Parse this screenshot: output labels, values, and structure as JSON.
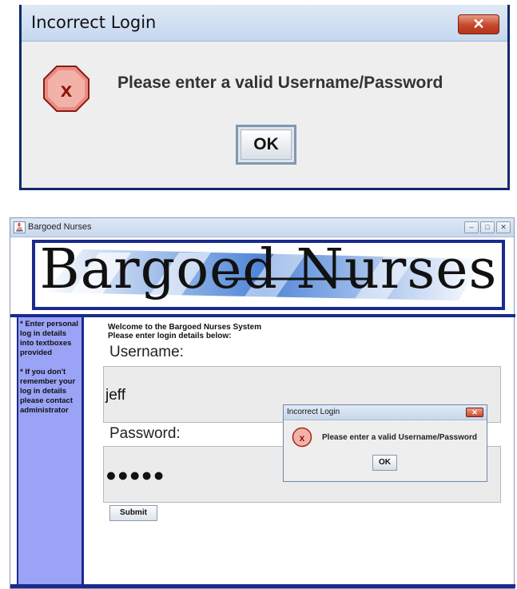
{
  "zoomed_dialog": {
    "title": "Incorrect Login",
    "close_label": "✕",
    "icon": "error-icon",
    "message": "Please enter a valid Username/Password",
    "ok_label": "OK"
  },
  "window": {
    "title": "Bargoed Nurses",
    "controls": {
      "minimize": "–",
      "maximize": "□",
      "close": "✕"
    }
  },
  "banner": {
    "text": "Bargoed Nurses"
  },
  "sidebar": {
    "notes": [
      "* Enter personal log in details into textboxes provided",
      "* If you don't remember your log in details please contact administrator"
    ]
  },
  "form": {
    "welcome_line1": "Welcome to the Bargoed Nurses System",
    "welcome_line2": "Please enter login details below:",
    "username_label": "Username:",
    "username_value": "jeff",
    "password_label": "Password:",
    "password_value": "●●●●●",
    "submit_label": "Submit"
  },
  "dialog": {
    "title": "Incorrect Login",
    "close_label": "✕",
    "icon": "error-icon",
    "message": "Please enter a valid Username/Password",
    "ok_label": "OK"
  },
  "colors": {
    "accent_navy": "#1b2a8c",
    "sidebar_bg": "#9aa3f5",
    "titlebar": "#c9d8ec",
    "error_red": "#d9534f"
  }
}
